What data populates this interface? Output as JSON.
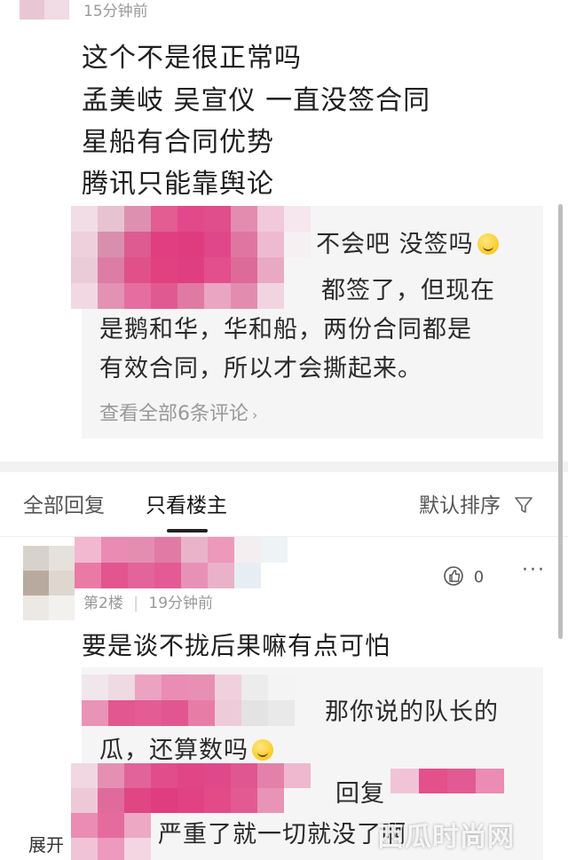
{
  "top_comment": {
    "time": "15分钟前",
    "lines": [
      "这个不是很正常吗",
      "孟美岐 吴宣仪 一直没签合同",
      "星船有合同优势",
      "腾讯只能靠舆论"
    ]
  },
  "replies": {
    "reply1": "不会吧 没签吗",
    "reply2_line1": "都签了，但现在",
    "reply2_line2": "是鹅和华，华和船，两份合同都是",
    "reply2_line3": "有效合同，所以才会撕起来。",
    "see_all": "查看全部6条评论"
  },
  "tabs": {
    "all": "全部回复",
    "owner_only": "只看楼主",
    "sort": "默认排序"
  },
  "floor2": {
    "floor": "第2楼",
    "time": "19分钟前",
    "likes": "0",
    "text": "要是谈不拢后果嘛有点可怕",
    "reply1_line1": "那你说的队长的",
    "reply1_line2": "瓜，还算数吗",
    "reply2_mid": "回复",
    "reply2_tail": "严重了就一切就没了啊",
    "expand": "展开"
  },
  "watermark": "西瓜时尚网"
}
